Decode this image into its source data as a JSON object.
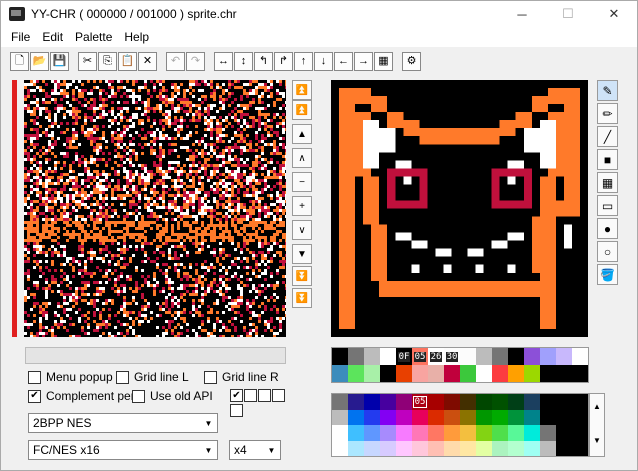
{
  "window": {
    "title": "YY-CHR ( 000000 / 001000 )  sprite.chr",
    "minimize": "─",
    "maximize": "☐",
    "close": "✕"
  },
  "menu": [
    {
      "label": "File"
    },
    {
      "label": "Edit"
    },
    {
      "label": "Palette"
    },
    {
      "label": "Help"
    }
  ],
  "toolbar": [
    {
      "name": "new-icon",
      "glyph": "🗋"
    },
    {
      "name": "open-icon",
      "glyph": "📂"
    },
    {
      "name": "save-icon",
      "glyph": "💾"
    },
    {
      "sep": true
    },
    {
      "name": "cut-icon",
      "glyph": "✂"
    },
    {
      "name": "copy-icon",
      "glyph": "⎘"
    },
    {
      "name": "paste-icon",
      "glyph": "📋"
    },
    {
      "name": "clear-icon",
      "glyph": "✕"
    },
    {
      "sep": true
    },
    {
      "name": "undo-icon",
      "glyph": "↶",
      "disabled": true
    },
    {
      "name": "redo-icon",
      "glyph": "↷",
      "disabled": true
    },
    {
      "sep": true
    },
    {
      "name": "flip-horizontal-icon",
      "glyph": "↔"
    },
    {
      "name": "flip-vertical-icon",
      "glyph": "↕"
    },
    {
      "name": "rotate-left-icon",
      "glyph": "↰"
    },
    {
      "name": "rotate-right-icon",
      "glyph": "↱"
    },
    {
      "name": "shift-up-icon",
      "glyph": "↑"
    },
    {
      "name": "shift-down-icon",
      "glyph": "↓"
    },
    {
      "name": "shift-left-icon",
      "glyph": "←"
    },
    {
      "name": "shift-right-icon",
      "glyph": "→"
    },
    {
      "name": "color-replace-icon",
      "glyph": "▦"
    },
    {
      "sep": true
    },
    {
      "name": "settings-icon",
      "glyph": "⚙"
    }
  ],
  "scroll_buttons": [
    {
      "name": "scroll-top-icon",
      "glyph": "⏫",
      "blue": false
    },
    {
      "name": "scroll-page-up-fast-icon",
      "glyph": "⏫",
      "blue": true
    },
    {
      "name": "scroll-page-up-icon",
      "glyph": "▲",
      "blue": false
    },
    {
      "name": "scroll-up-icon",
      "glyph": "∧",
      "blue": false
    },
    {
      "name": "scroll-minus-icon",
      "glyph": "−",
      "blue": false
    },
    {
      "name": "scroll-plus-icon",
      "glyph": "+",
      "blue": false
    },
    {
      "name": "scroll-down-icon",
      "glyph": "∨",
      "blue": false
    },
    {
      "name": "scroll-page-down-icon",
      "glyph": "▼",
      "blue": false
    },
    {
      "name": "scroll-page-down-fast-icon",
      "glyph": "⏬",
      "blue": true
    },
    {
      "name": "scroll-bottom-icon",
      "glyph": "⏬",
      "blue": false
    }
  ],
  "tools": [
    {
      "name": "pen-tool-icon",
      "glyph": "✎",
      "active": true
    },
    {
      "name": "pencil-tool-icon",
      "glyph": "✏"
    },
    {
      "name": "line-tool-icon",
      "glyph": "╱"
    },
    {
      "name": "rect-fill-tool-icon",
      "glyph": "■"
    },
    {
      "name": "pattern-fill-tool-icon",
      "glyph": "▦"
    },
    {
      "name": "rect-outline-tool-icon",
      "glyph": "▭"
    },
    {
      "name": "circle-fill-tool-icon",
      "glyph": "●"
    },
    {
      "name": "circle-outline-tool-icon",
      "glyph": "○"
    },
    {
      "name": "fill-bucket-tool-icon",
      "glyph": "🪣"
    }
  ],
  "checkboxes": {
    "menu_popup": {
      "label": "Menu popup",
      "checked": false
    },
    "grid_line_l": {
      "label": "Grid line L",
      "checked": false
    },
    "grid_line_r": {
      "label": "Grid line R",
      "checked": false
    },
    "complement_pen": {
      "label": "Complement pen",
      "checked": true
    },
    "use_old_api": {
      "label": "Use old API",
      "checked": false
    }
  },
  "selects": {
    "format": "2BPP NES",
    "pattern": "FC/NES x16",
    "zoom": "x4"
  },
  "current_palette": [
    "#000000",
    "#757575",
    "#bcbcbc",
    "#ffffff",
    "#000000",
    "#fc7460",
    "#ffffff",
    "#fcfcfc",
    "#fcfcfc",
    "#bcbcbc",
    "#757575",
    "#000000",
    "#8c50d8",
    "#a0a0fc",
    "#c8b8fc",
    "#ffffff"
  ],
  "current_palette_row2": [
    "#3c8cbc",
    "#5ce45c",
    "#a8f0a8",
    "#000000",
    "#e84000",
    "#f8a4a0",
    "#e8b0a8",
    "#c0003c",
    "#3cc83c",
    "#ffffff",
    "#fc3c40",
    "#ffa000",
    "#9cd800",
    "#000000",
    "#000000",
    "#000000"
  ],
  "selected_labels": {
    "c0": "0F",
    "c1": "05",
    "c2": "26",
    "c3": "30"
  },
  "big_palette_label": "05",
  "big_palette": [
    [
      "#757575",
      "#271b8f",
      "#0000ab",
      "#47009f",
      "#8f0077",
      "#ab0013",
      "#a70000",
      "#7f0b00",
      "#432f00",
      "#004700",
      "#005100",
      "#003f17",
      "#1b3f5f",
      "#000000",
      "#000000",
      "#000000"
    ],
    [
      "#bcbcbc",
      "#0073ef",
      "#233bef",
      "#8300f3",
      "#bf00bf",
      "#e7005b",
      "#db2b00",
      "#cb4f0f",
      "#8b7300",
      "#009700",
      "#00ab00",
      "#00933b",
      "#00838b",
      "#000000",
      "#000000",
      "#000000"
    ],
    [
      "#ffffff",
      "#3fbfff",
      "#5f97ff",
      "#a78bfd",
      "#f77bff",
      "#ff77b7",
      "#ff7763",
      "#ff9b3b",
      "#f3bf3f",
      "#83d313",
      "#4fdf4b",
      "#58f898",
      "#00ebdb",
      "#757575",
      "#000000",
      "#000000"
    ],
    [
      "#ffffff",
      "#abe7ff",
      "#c7d7ff",
      "#d7cbff",
      "#ffc7ff",
      "#ffc7db",
      "#ffbfb3",
      "#ffdbab",
      "#ffe7a3",
      "#e3ffa3",
      "#abf3bf",
      "#b3ffcf",
      "#9ffff3",
      "#bcbcbc",
      "#000000",
      "#000000"
    ]
  ]
}
